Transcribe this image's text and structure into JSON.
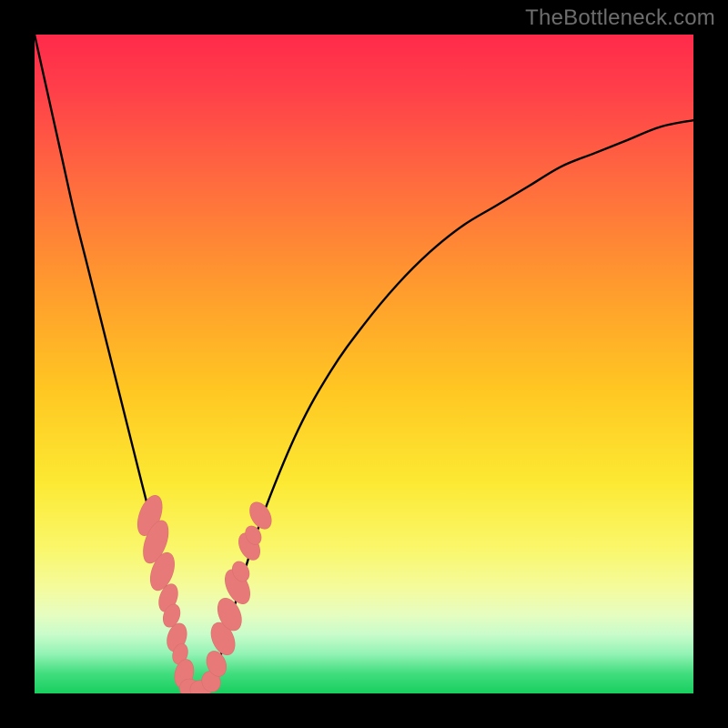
{
  "watermark": "TheBottleneck.com",
  "colors": {
    "frame": "#000000",
    "curve": "#000000",
    "marker_fill": "#e77a78",
    "marker_stroke": "#d96f6d"
  },
  "chart_data": {
    "type": "line",
    "title": "",
    "xlabel": "",
    "ylabel": "",
    "xlim": [
      0,
      100
    ],
    "ylim": [
      0,
      100
    ],
    "grid": false,
    "legend": false,
    "series": [
      {
        "name": "bottleneck-curve",
        "x": [
          0,
          2,
          4,
          6,
          8,
          10,
          12,
          14,
          16,
          18,
          20,
          22,
          23,
          24,
          25,
          26,
          28,
          30,
          32,
          35,
          40,
          45,
          50,
          55,
          60,
          65,
          70,
          75,
          80,
          85,
          90,
          95,
          100
        ],
        "y": [
          100,
          91,
          82,
          73,
          65,
          57,
          49,
          41,
          33,
          25,
          16,
          7,
          3,
          0,
          0,
          0,
          5,
          12,
          19,
          28,
          40,
          49,
          56,
          62,
          67,
          71,
          74,
          77,
          80,
          82,
          84,
          86,
          87
        ]
      }
    ],
    "markers": [
      {
        "x": 17.5,
        "y": 27,
        "rx": 1.6,
        "ry": 3.2,
        "rot": 20
      },
      {
        "x": 18.4,
        "y": 23,
        "rx": 1.6,
        "ry": 3.4,
        "rot": 20
      },
      {
        "x": 19.4,
        "y": 18.5,
        "rx": 1.6,
        "ry": 3.0,
        "rot": 20
      },
      {
        "x": 20.3,
        "y": 14.5,
        "rx": 1.3,
        "ry": 2.2,
        "rot": 20
      },
      {
        "x": 20.8,
        "y": 11.8,
        "rx": 1.2,
        "ry": 1.8,
        "rot": 20
      },
      {
        "x": 21.6,
        "y": 8.5,
        "rx": 1.4,
        "ry": 2.2,
        "rot": 18
      },
      {
        "x": 22.1,
        "y": 6.0,
        "rx": 1.1,
        "ry": 1.6,
        "rot": 18
      },
      {
        "x": 22.7,
        "y": 3.0,
        "rx": 1.4,
        "ry": 2.2,
        "rot": 14
      },
      {
        "x": 23.5,
        "y": 0.8,
        "rx": 1.5,
        "ry": 1.4,
        "rot": 0
      },
      {
        "x": 25.2,
        "y": 0.6,
        "rx": 1.6,
        "ry": 1.4,
        "rot": 0
      },
      {
        "x": 26.8,
        "y": 1.8,
        "rx": 1.4,
        "ry": 1.6,
        "rot": -20
      },
      {
        "x": 27.6,
        "y": 4.5,
        "rx": 1.4,
        "ry": 2.0,
        "rot": -22
      },
      {
        "x": 28.6,
        "y": 8.3,
        "rx": 1.6,
        "ry": 2.6,
        "rot": -24
      },
      {
        "x": 29.6,
        "y": 12.0,
        "rx": 1.6,
        "ry": 2.6,
        "rot": -24
      },
      {
        "x": 30.8,
        "y": 16.2,
        "rx": 1.6,
        "ry": 2.8,
        "rot": -26
      },
      {
        "x": 31.3,
        "y": 18.5,
        "rx": 1.2,
        "ry": 1.6,
        "rot": -26
      },
      {
        "x": 32.6,
        "y": 22.3,
        "rx": 1.4,
        "ry": 2.2,
        "rot": -28
      },
      {
        "x": 33.2,
        "y": 24.0,
        "rx": 1.1,
        "ry": 1.5,
        "rot": -28
      },
      {
        "x": 34.3,
        "y": 27.0,
        "rx": 1.4,
        "ry": 2.2,
        "rot": -30
      }
    ]
  }
}
